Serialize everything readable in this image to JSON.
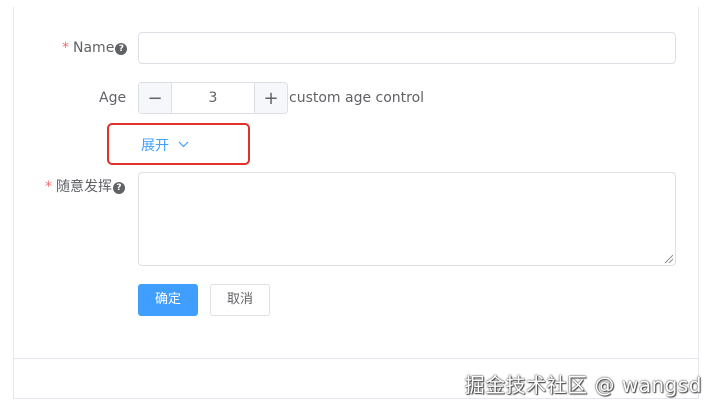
{
  "form": {
    "name": {
      "label": "Name",
      "required": true,
      "help": "?",
      "value": ""
    },
    "age": {
      "label": "Age",
      "value": "3",
      "decrement": "−",
      "increment": "+",
      "extra": "custom age control"
    },
    "expand": {
      "label": "展开",
      "chevron": "chevron-down-icon"
    },
    "free": {
      "label": "随意发挥",
      "required": true,
      "help": "?",
      "value": ""
    },
    "buttons": {
      "confirm": "确定",
      "cancel": "取消"
    },
    "required_mark": "*"
  },
  "watermark": "掘金技术社区 @ wangsd",
  "colors": {
    "primary": "#409eff",
    "required": "#f56c6c",
    "highlight_border": "#e0312b"
  }
}
